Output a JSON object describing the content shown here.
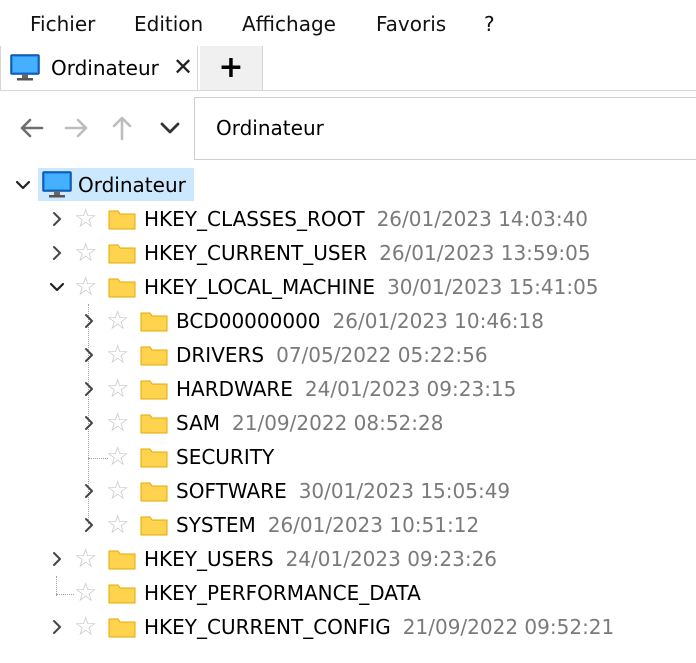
{
  "menu": {
    "file": "Fichier",
    "edit": "Edition",
    "view": "Affichage",
    "favorites": "Favoris",
    "help": "?"
  },
  "tab": {
    "label": "Ordinateur",
    "close": "✕",
    "new_tab": "+"
  },
  "address": {
    "value": "Ordinateur"
  },
  "tree": {
    "root": "Ordinateur",
    "hives": [
      {
        "name": "HKEY_CLASSES_ROOT",
        "date": "26/01/2023 14:03:40"
      },
      {
        "name": "HKEY_CURRENT_USER",
        "date": "26/01/2023 13:59:05"
      },
      {
        "name": "HKEY_LOCAL_MACHINE",
        "date": "30/01/2023 15:41:05"
      },
      {
        "name": "HKEY_USERS",
        "date": "24/01/2023 09:23:26"
      },
      {
        "name": "HKEY_PERFORMANCE_DATA",
        "date": ""
      },
      {
        "name": "HKEY_CURRENT_CONFIG",
        "date": "21/09/2022 09:52:21"
      }
    ],
    "hklm_children": [
      {
        "name": "BCD00000000",
        "date": "26/01/2023 10:46:18"
      },
      {
        "name": "DRIVERS",
        "date": "07/05/2022 05:22:56"
      },
      {
        "name": "HARDWARE",
        "date": "24/01/2023 09:23:15"
      },
      {
        "name": "SAM",
        "date": "21/09/2022 08:52:28"
      },
      {
        "name": "SECURITY",
        "date": ""
      },
      {
        "name": "SOFTWARE",
        "date": "30/01/2023 15:05:49"
      },
      {
        "name": "SYSTEM",
        "date": "26/01/2023 10:51:12"
      }
    ]
  },
  "colors": {
    "selection": "#cce8ff",
    "folder": "#ffd34e",
    "date": "#7a7a7a"
  }
}
